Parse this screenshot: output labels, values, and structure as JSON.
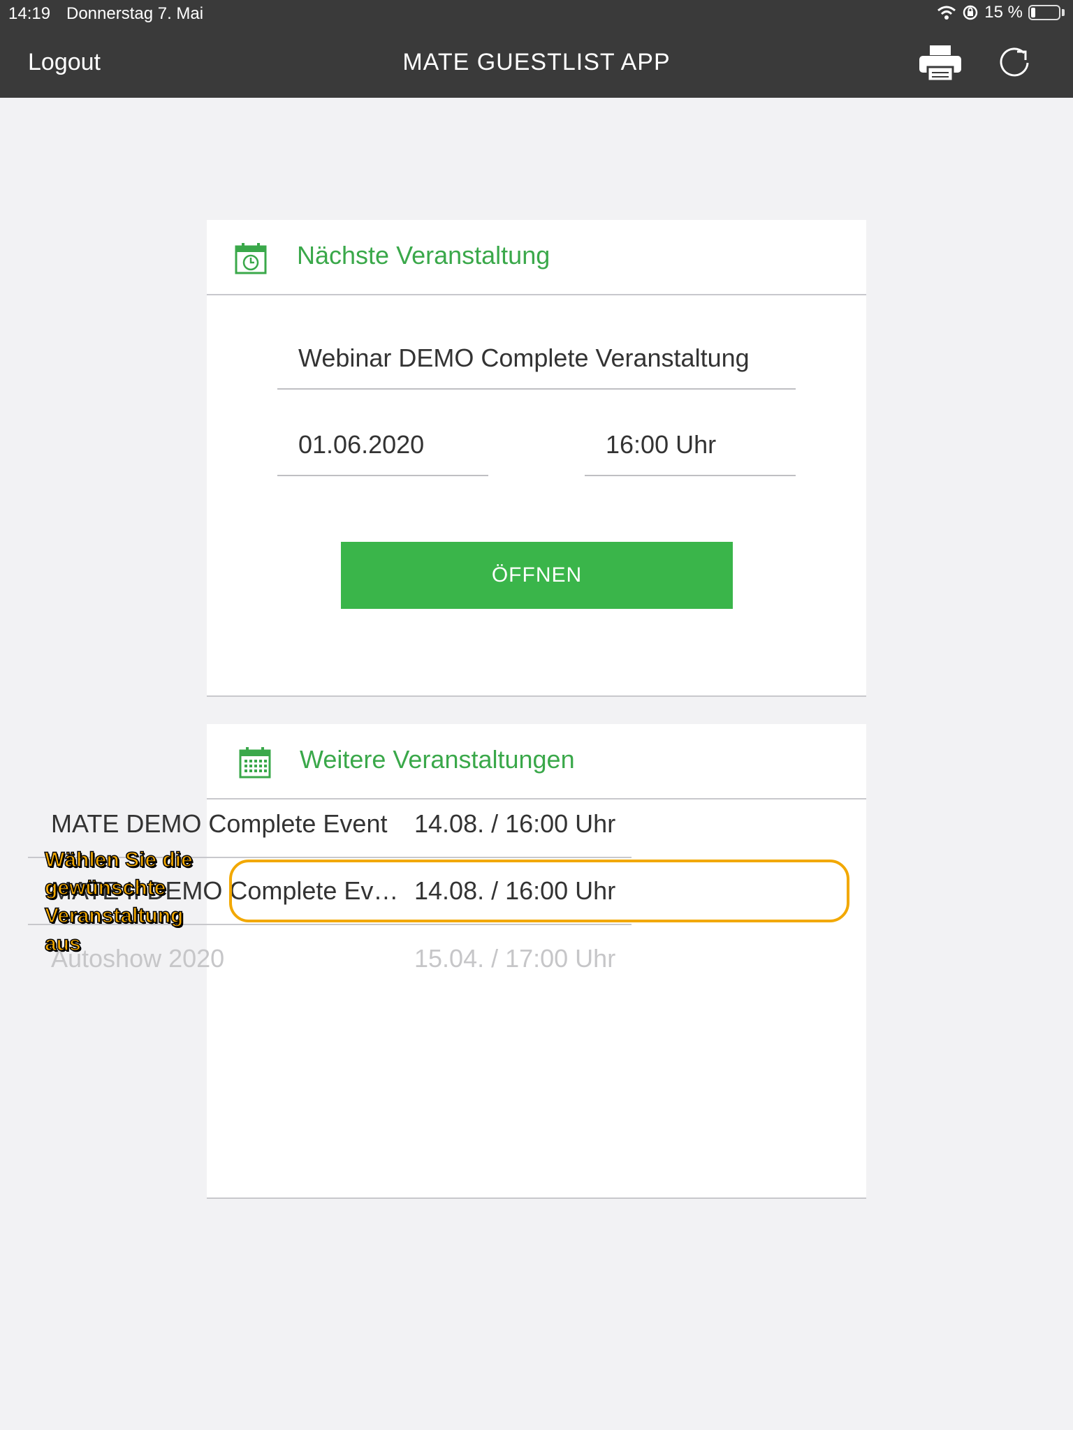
{
  "status_bar": {
    "time": "14:19",
    "date": "Donnerstag 7. Mai",
    "battery": "15 %"
  },
  "navbar": {
    "logout_label": "Logout",
    "title": "MATE GUESTLIST APP"
  },
  "next_event": {
    "section_title": "Nächste Veranstaltung",
    "name": "Webinar DEMO Complete Veranstaltung",
    "date": "01.06.2020",
    "time": "16:00 Uhr",
    "open_label": "ÖFFNEN"
  },
  "more_events": {
    "section_title": "Weitere Veranstaltungen",
    "items": [
      {
        "name": "MATE DEMO Complete Event",
        "when": "14.08. / 16:00 Uhr"
      },
      {
        "name": "MATE II DEMO Complete Ev…",
        "when": "14.08. / 16:00 Uhr"
      },
      {
        "name": "Autoshow 2020",
        "when": "15.04. / 17:00 Uhr"
      }
    ]
  },
  "annotation": {
    "line1": "Wählen Sie die",
    "line2": "gewünschte",
    "line3": "Veranstaltung",
    "line4": "aus"
  },
  "colors": {
    "accent_green": "#3ab54a",
    "highlight_orange": "#f2a800",
    "topbar": "#3a3a3a"
  }
}
